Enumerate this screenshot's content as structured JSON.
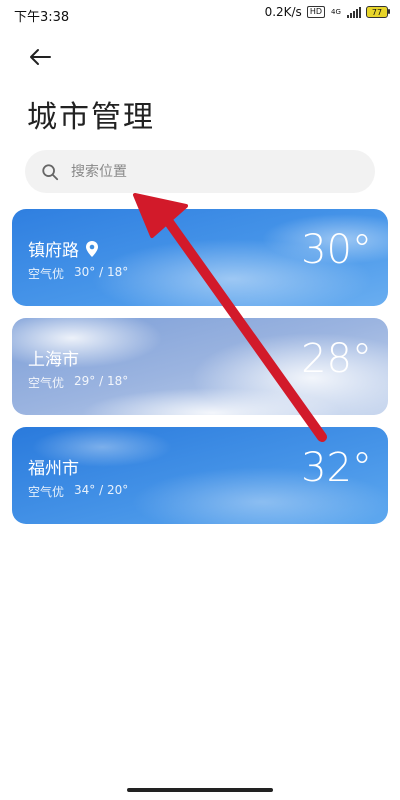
{
  "status": {
    "time": "下午3:38",
    "net_speed": "0.2K/s",
    "hd": "HD",
    "net_type": "4G",
    "battery": "77"
  },
  "header": {
    "title": "城市管理"
  },
  "search": {
    "placeholder": "搜索位置"
  },
  "cities": [
    {
      "name": "镇府路",
      "air": "空气优",
      "range": "30° / 18°",
      "temp": "30°",
      "located": true
    },
    {
      "name": "上海市",
      "air": "空气优",
      "range": "29° / 18°",
      "temp": "28°",
      "located": false
    },
    {
      "name": "福州市",
      "air": "空气优",
      "range": "34° / 20°",
      "temp": "32°",
      "located": false
    }
  ],
  "colors": {
    "accent_arrow": "#d21a2a",
    "sky_blue": "#3f8fe0",
    "cloudy_blue": "#9cb5e0"
  }
}
